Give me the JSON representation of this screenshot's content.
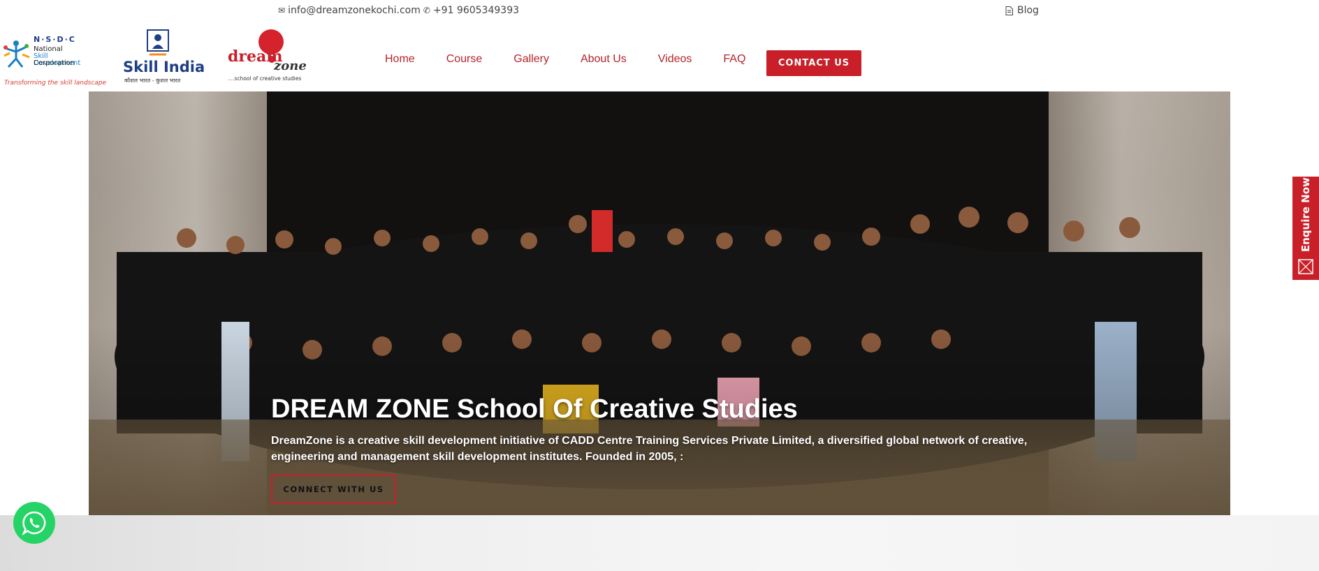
{
  "topbar": {
    "email": "info@dreamzonekochi.com",
    "phone": "+91 9605349393",
    "blog_label": "Blog"
  },
  "logos": {
    "nsdc": {
      "title": "N·S·D·C",
      "line1": "National",
      "line2": "Skill Development",
      "line3": "Corporation",
      "tagline": "Transforming the skill landscape"
    },
    "skill_india": {
      "title": "Skill India",
      "subtitle": "कौशल भारत - कुशल भारत"
    },
    "dreamzone": {
      "word1": "dream",
      "word2": "zone",
      "subtitle_dots": "....",
      "subtitle": "school of creative studies"
    }
  },
  "nav": {
    "items": [
      {
        "label": "Home"
      },
      {
        "label": "Course"
      },
      {
        "label": "Gallery"
      },
      {
        "label": "About Us"
      },
      {
        "label": "Videos"
      },
      {
        "label": "FAQ"
      }
    ],
    "contact_label": "CONTACT US"
  },
  "hero": {
    "title": "DREAM ZONE School Of Creative Studies",
    "description": "DreamZone is a creative skill development initiative of CADD Centre Training Services Private Limited, a diversified global network of creative, engineering and management skill development institutes. Founded in 2005, :",
    "button_label": "CONNECT WITH US"
  },
  "side_tab": {
    "label": "Enquire Now"
  },
  "colors": {
    "brand_red": "#c81f28",
    "nav_red": "#b5242b",
    "whatsapp_green": "#25d366"
  },
  "icons": {
    "email": "envelope-icon",
    "phone": "phone-icon",
    "blog": "document-icon",
    "whatsapp": "whatsapp-icon",
    "enquire": "envelope-icon"
  }
}
